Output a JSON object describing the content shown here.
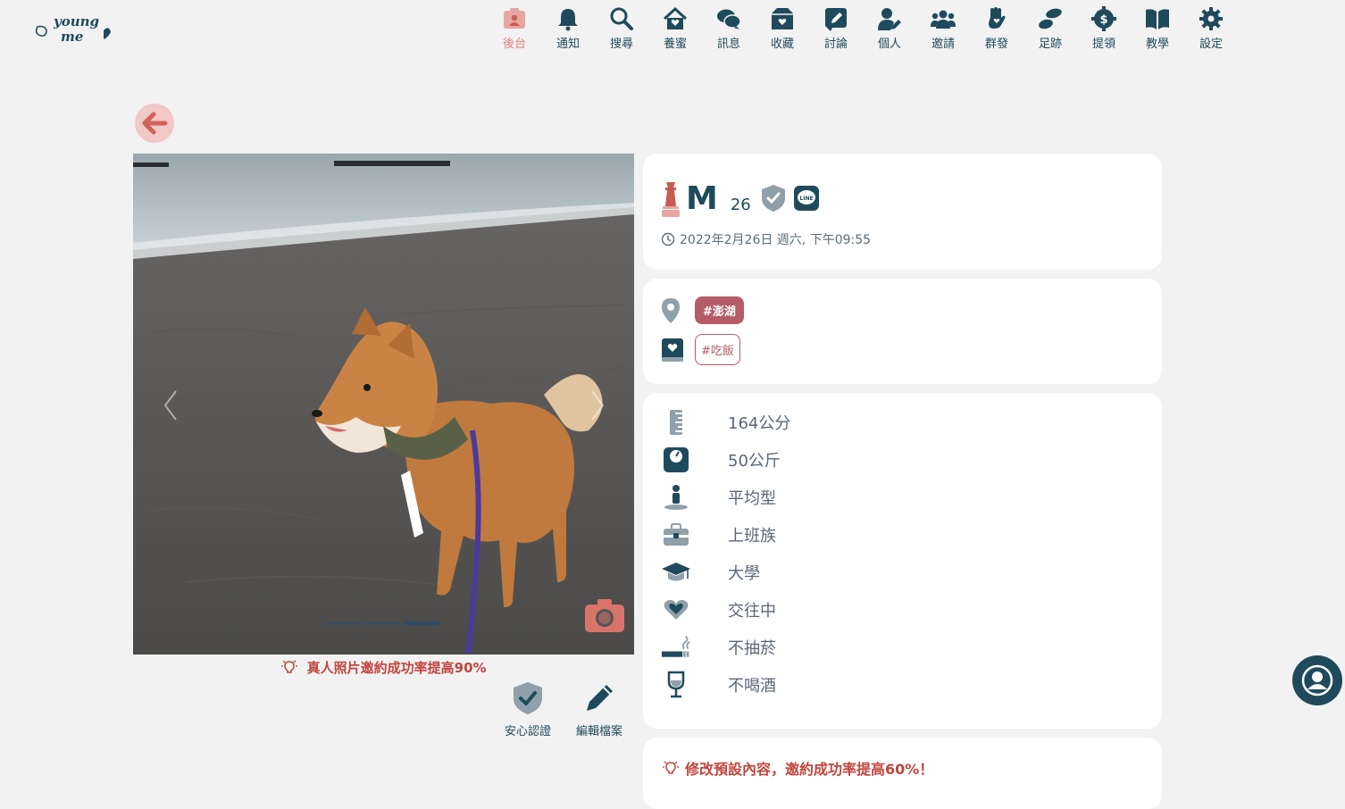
{
  "logo": {
    "text": "young me"
  },
  "nav": [
    {
      "label": "後台",
      "icon": "dashboard-icon"
    },
    {
      "label": "通知",
      "icon": "bell-icon"
    },
    {
      "label": "搜尋",
      "icon": "search-icon"
    },
    {
      "label": "養蜜",
      "icon": "house-heart-icon"
    },
    {
      "label": "訊息",
      "icon": "chat-icon"
    },
    {
      "label": "收藏",
      "icon": "box-heart-icon"
    },
    {
      "label": "討論",
      "icon": "edit-square-icon"
    },
    {
      "label": "個人",
      "icon": "user-edit-icon"
    },
    {
      "label": "邀請",
      "icon": "users-group-icon"
    },
    {
      "label": "群發",
      "icon": "hand-heart-icon"
    },
    {
      "label": "足跡",
      "icon": "footprint-icon"
    },
    {
      "label": "提領",
      "icon": "dollar-gear-icon"
    },
    {
      "label": "教學",
      "icon": "book-icon"
    },
    {
      "label": "設定",
      "icon": "gear-icon"
    }
  ],
  "active_nav": "後台",
  "photo": {
    "slides": 3,
    "active_slide": 3
  },
  "photo_tip": "真人照片邀約成功率提高90%",
  "actions": {
    "verify_label": "安心認證",
    "edit_label": "編輯檔案"
  },
  "profile": {
    "name": "M",
    "age": "26",
    "timestamp": "2022年2月26日 週六, 下午09:55"
  },
  "tags": {
    "location": "#澎湖",
    "interest": "#吃飯"
  },
  "attributes": [
    {
      "icon": "ruler-icon",
      "value": "164公分"
    },
    {
      "icon": "scale-icon",
      "value": "50公斤"
    },
    {
      "icon": "body-type-icon",
      "value": "平均型"
    },
    {
      "icon": "briefcase-icon",
      "value": "上班族"
    },
    {
      "icon": "graduation-cap-icon",
      "value": "大學"
    },
    {
      "icon": "heart-icon",
      "value": "交往中"
    },
    {
      "icon": "smoking-icon",
      "value": "不抽菸"
    },
    {
      "icon": "wine-glass-icon",
      "value": "不喝酒"
    }
  ],
  "bottom_tip": "修改預設內容，邀約成功率提高60%！",
  "colors": {
    "primary": "#1f4a5c",
    "accent": "#d9827b",
    "tag": "#b65c66",
    "tip": "#c0463e"
  }
}
